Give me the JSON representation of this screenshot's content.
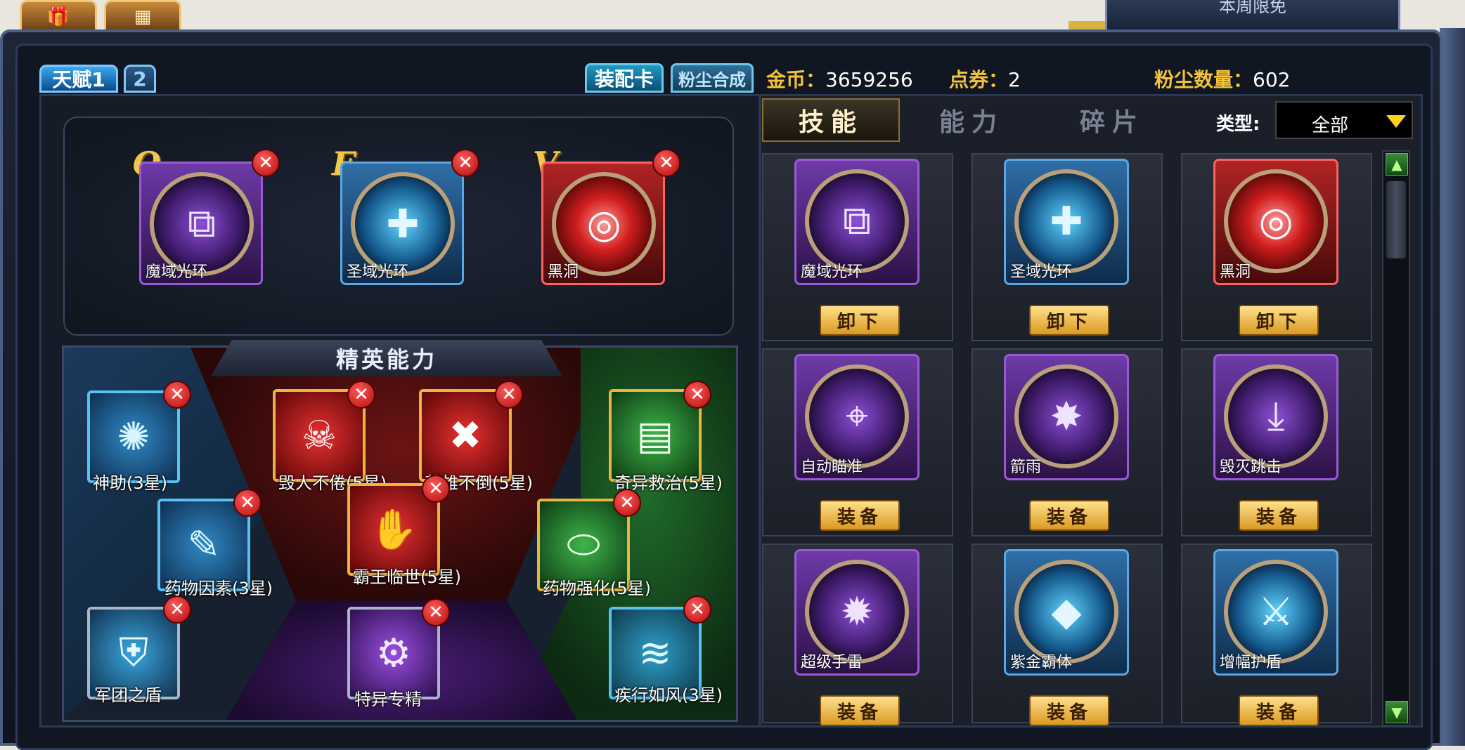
{
  "top": {
    "weekly_free": "本周限免"
  },
  "tabs": {
    "talent1": "天赋1",
    "talent2": "2",
    "equip_card": "装配卡",
    "dust": "粉尘合成"
  },
  "stats": {
    "gold_label": "金币：",
    "gold_value": "3659256",
    "coupon_label": "点券：",
    "coupon_value": "2",
    "dust_label": "粉尘数量：",
    "dust_value": "602"
  },
  "equipped": [
    {
      "key": "Q",
      "name": "魔域光环",
      "rarity": "purple",
      "icon": "bullets-icon",
      "glyph": "⧉"
    },
    {
      "key": "E",
      "name": "圣域光环",
      "rarity": "blue",
      "icon": "plus-heal-icon",
      "glyph": "✚"
    },
    {
      "key": "V",
      "name": "黑洞",
      "rarity": "red",
      "icon": "vortex-icon",
      "glyph": "◎"
    }
  ],
  "elite": {
    "title": "精英能力",
    "items": [
      {
        "name": "神助(3星)",
        "icon": "strongman-icon",
        "glyph": "✺"
      },
      {
        "name": "药物因素(3星)",
        "icon": "syringe-icon",
        "glyph": "✎"
      },
      {
        "name": "军团之盾",
        "icon": "shield-plus-icon",
        "glyph": "⛨"
      },
      {
        "name": "毁人不倦(5星)",
        "icon": "skulls-icon",
        "glyph": "☠"
      },
      {
        "name": "英雄不倒(5星)",
        "icon": "crossed-guns-icon",
        "glyph": "✖"
      },
      {
        "name": "霸王临世(5星)",
        "icon": "claw-icon",
        "glyph": "✋"
      },
      {
        "name": "特异专精",
        "icon": "gear-plus-icon",
        "glyph": "⚙"
      },
      {
        "name": "奇异救治(5星)",
        "icon": "bandage-icon",
        "glyph": "▤"
      },
      {
        "name": "药物强化(5星)",
        "icon": "capsule-icon",
        "glyph": "⬭"
      },
      {
        "name": "疾行如风(3星)",
        "icon": "tornado-icon",
        "glyph": "≋"
      }
    ]
  },
  "right": {
    "tabs": [
      "技能",
      "能力",
      "碎片"
    ],
    "type_label": "类型:",
    "type_value": "全部",
    "cards": [
      {
        "name": "魔域光环",
        "btn": "卸下",
        "rarity": "purple",
        "icon": "bullets-icon",
        "glyph": "⧉"
      },
      {
        "name": "圣域光环",
        "btn": "卸下",
        "rarity": "blue",
        "icon": "plus-heal-icon",
        "glyph": "✚"
      },
      {
        "name": "黑洞",
        "btn": "卸下",
        "rarity": "red",
        "icon": "vortex-icon",
        "glyph": "◎"
      },
      {
        "name": "自动瞄准",
        "btn": "装备",
        "rarity": "purple",
        "icon": "target-icon",
        "glyph": "⌖"
      },
      {
        "name": "箭雨",
        "btn": "装备",
        "rarity": "purple",
        "icon": "burst-icon",
        "glyph": "✸"
      },
      {
        "name": "毁灭跳击",
        "btn": "装备",
        "rarity": "purple",
        "icon": "jump-strike-icon",
        "glyph": "⤓"
      },
      {
        "name": "超级手雷",
        "btn": "装备",
        "rarity": "purple",
        "icon": "grenade-icon",
        "glyph": "✹"
      },
      {
        "name": "紫金霸体",
        "btn": "装备",
        "rarity": "blue",
        "icon": "crystal-icon",
        "glyph": "◆"
      },
      {
        "name": "增幅护盾",
        "btn": "装备",
        "rarity": "blue",
        "icon": "sword-shield-icon",
        "glyph": "⚔"
      }
    ]
  }
}
